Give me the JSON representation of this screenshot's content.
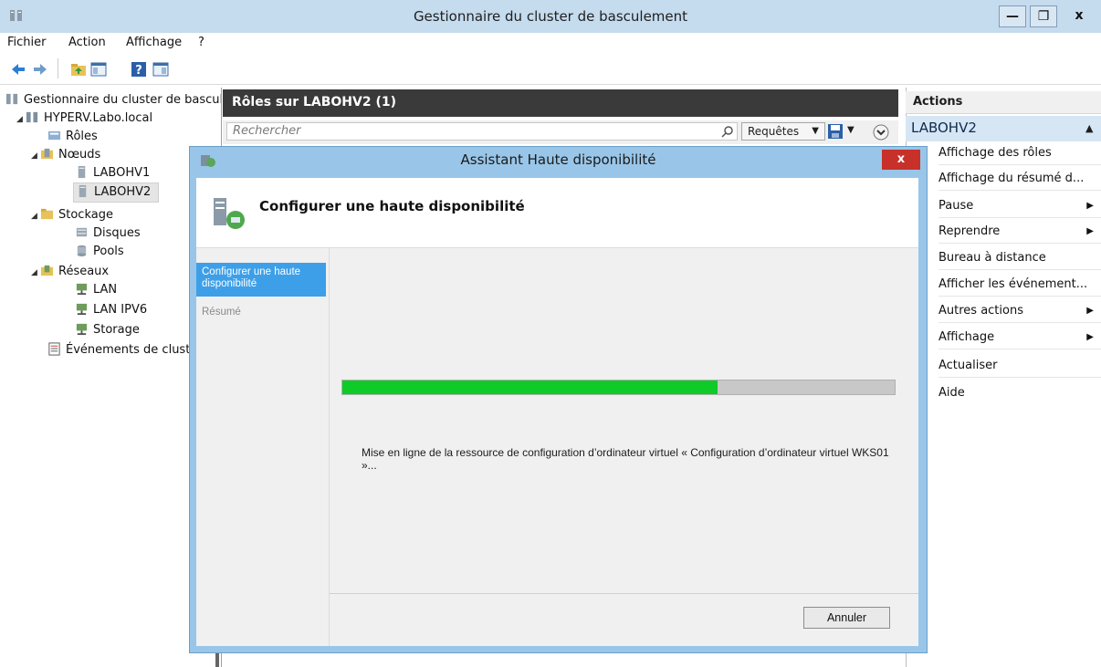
{
  "window": {
    "title": "Gestionnaire du cluster de basculement",
    "minimize": "—",
    "maximize": "❐",
    "close": "x"
  },
  "menu": [
    "Fichier",
    "Action",
    "Affichage",
    "?"
  ],
  "tree": {
    "root": "Gestionnaire du cluster de basculement",
    "cluster": "HYPERV.Labo.local",
    "roles": "Rôles",
    "nodes": "Nœuds",
    "node1": "LABOHV1",
    "node2": "LABOHV2",
    "storage": "Stockage",
    "disks": "Disques",
    "pools": "Pools",
    "networks": "Réseaux",
    "lan": "LAN",
    "lanipv6": "LAN IPV6",
    "storage_net": "Storage",
    "events": "Événements de cluster"
  },
  "center": {
    "title": "Rôles sur LABOHV2 (1)",
    "search_placeholder": "Rechercher",
    "queries": "Requêtes"
  },
  "actions": {
    "title": "Actions",
    "section": "LABOHV2",
    "items": [
      {
        "label": "Affichage des rôles"
      },
      {
        "label": "Affichage du résumé d..."
      },
      {
        "label": "Pause"
      },
      {
        "label": "Reprendre"
      },
      {
        "label": "Bureau à distance"
      },
      {
        "label": "Afficher les événement..."
      },
      {
        "label": "Autres actions"
      },
      {
        "label": "Affichage"
      },
      {
        "label": "Actualiser"
      },
      {
        "label": "Aide"
      }
    ]
  },
  "dialog": {
    "title": "Assistant Haute disponibilité",
    "close": "x",
    "heading": "Configurer une haute disponibilité",
    "steps": [
      "Configurer une haute disponibilité",
      "Résumé"
    ],
    "progress": 0.68,
    "status": "Mise en ligne de la ressource de configuration d’ordinateur virtuel « Configuration d’ordinateur virtuel WKS01 »...",
    "cancel": "Annuler"
  },
  "colors": {
    "titlebar": "#c5dbee",
    "progress": "#0fcb27",
    "step_active": "#3d9fe8",
    "close": "#c7312a"
  }
}
